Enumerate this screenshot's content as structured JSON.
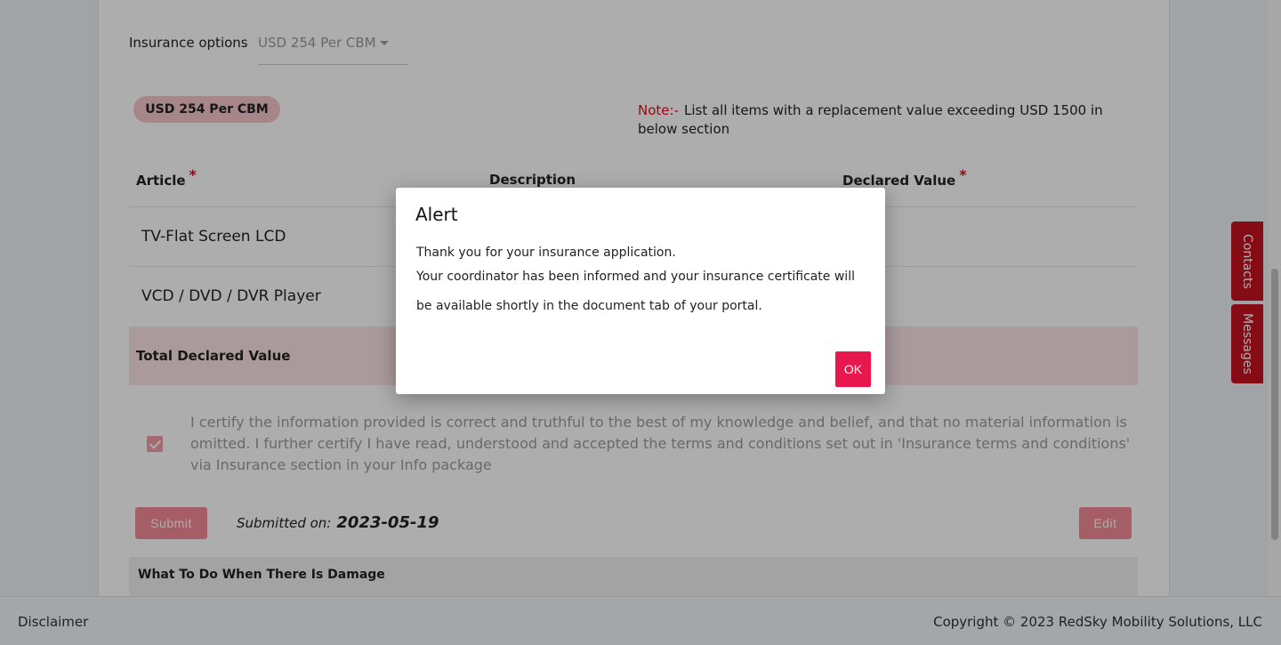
{
  "insurance": {
    "label": "Insurance options",
    "selected": "USD 254 Per CBM",
    "pill": "USD 254 Per CBM"
  },
  "note": {
    "label": "Note:-",
    "text": "List all items with a replacement value exceeding USD 1500 in below section"
  },
  "table": {
    "headers": [
      "Article",
      "Description",
      "Declared Value"
    ],
    "rows": [
      {
        "article": "TV-Flat Screen LCD"
      },
      {
        "article": "VCD / DVD / DVR Player"
      }
    ],
    "total_label": "Total Declared Value"
  },
  "certification": {
    "checked": true,
    "text": "I certify the information provided is correct and truthful to the best of my knowledge and belief, and that no material information is omitted. I further certify I have read, understood and accepted the terms and conditions set out in 'Insurance terms and conditions' via Insurance section in your Info package"
  },
  "actions": {
    "submit_label": "Submit",
    "submitted_label": "Submitted on:",
    "submitted_date": "2023-05-19",
    "edit_label": "Edit"
  },
  "damage": {
    "title": "What To Do When There Is Damage"
  },
  "side_tabs": {
    "contacts": "Contacts",
    "messages": "Messages"
  },
  "footer": {
    "disclaimer": "Disclaimer",
    "copyright": "Copyright © 2023 RedSky Mobility Solutions, LLC"
  },
  "dialog": {
    "title": "Alert",
    "line1": "Thank you for your insurance application.",
    "line2": "Your coordinator has been informed and your insurance certificate will be available shortly in the document tab of your portal.",
    "ok_label": "OK"
  },
  "colors": {
    "accent": "#e8174d",
    "brand_red": "#c4121f",
    "pill_bg": "#f7c6cb",
    "total_row_bg": "#fde3e6"
  }
}
